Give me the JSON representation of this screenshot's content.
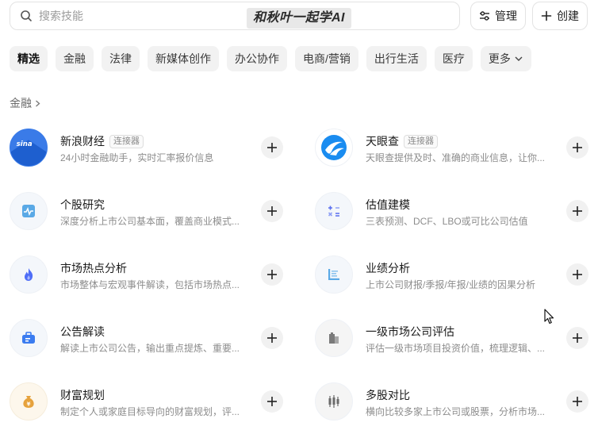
{
  "search": {
    "placeholder": "搜索技能"
  },
  "watermark": "和秋叶一起学AI",
  "toolbar": {
    "manage_label": "管理",
    "create_label": "创建"
  },
  "categories": [
    {
      "label": "精选",
      "active": true
    },
    {
      "label": "金融"
    },
    {
      "label": "法律"
    },
    {
      "label": "新媒体创作"
    },
    {
      "label": "办公协作"
    },
    {
      "label": "电商/营销"
    },
    {
      "label": "出行生活"
    },
    {
      "label": "医疗"
    },
    {
      "label": "更多"
    }
  ],
  "section": {
    "title": "金融"
  },
  "items": [
    {
      "name": "新浪财经",
      "badge": "连接器",
      "desc": "24小时金融助手，实时汇率报价信息",
      "icon": "sina-logo"
    },
    {
      "name": "天眼查",
      "badge": "连接器",
      "desc": "天眼查提供及时、准确的商业信息，让你...",
      "icon": "tianyancha-logo"
    },
    {
      "name": "个股研究",
      "desc": "深度分析上市公司基本面，覆盖商业模式...",
      "icon": "pulse-chart-icon"
    },
    {
      "name": "估值建模",
      "desc": "三表预测、DCF、LBO或可比公司估值",
      "icon": "calculator-icon"
    },
    {
      "name": "市场热点分析",
      "desc": "市场整体与宏观事件解读，包括市场热点...",
      "icon": "flame-icon"
    },
    {
      "name": "业绩分析",
      "desc": "上市公司财报/季报/年报/业绩的因果分析",
      "icon": "report-icon"
    },
    {
      "name": "公告解读",
      "desc": "解读上市公司公告，输出重点提炼、重要...",
      "icon": "briefcase-icon"
    },
    {
      "name": "一级市场公司评估",
      "desc": "评估一级市场项目投资价值，梳理逻辑、...",
      "icon": "building-icon"
    },
    {
      "name": "财富规划",
      "desc": "制定个人或家庭目标导向的财富规划，评...",
      "icon": "money-bag-icon"
    },
    {
      "name": "多股对比",
      "desc": "横向比较多家上市公司或股票，分析市场...",
      "icon": "candlestick-icon"
    }
  ],
  "colors": {
    "accent_blue": "#3b7cf0",
    "fire": "#4f6ef7",
    "gold": "#e6a23c"
  }
}
